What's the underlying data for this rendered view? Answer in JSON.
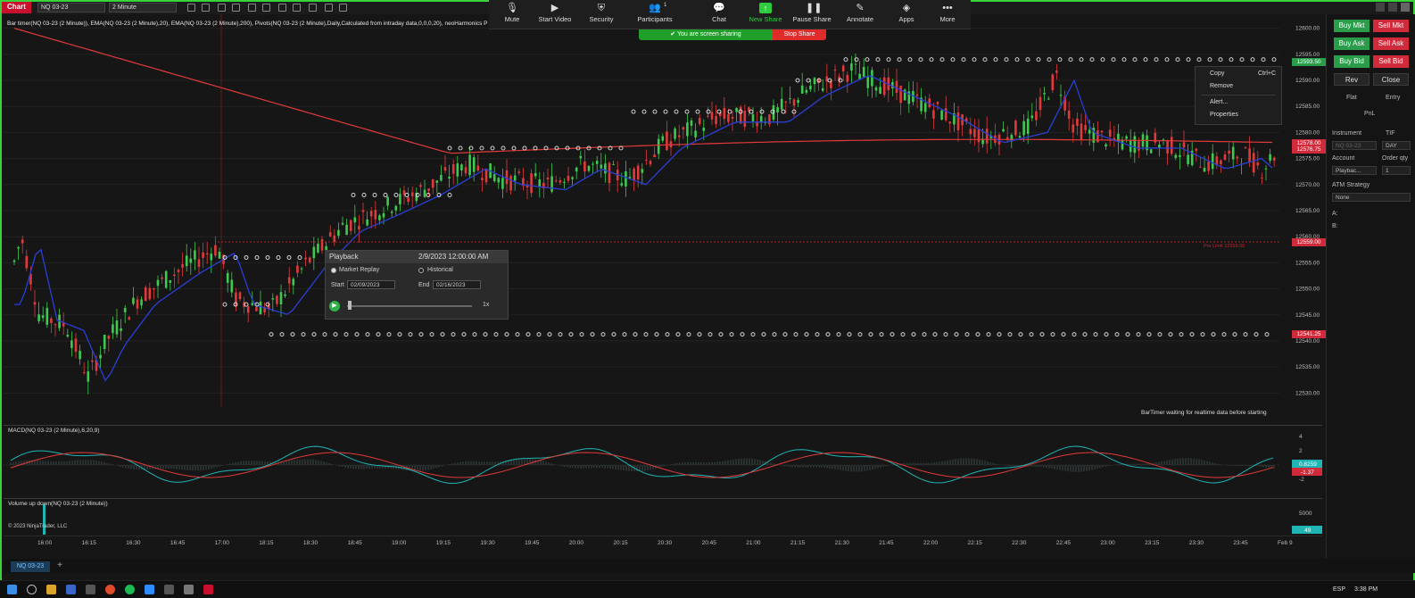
{
  "window": {
    "app_title": "Chart",
    "instrument_select": "NQ 03-23",
    "interval_select": "2 Minute"
  },
  "zoom": {
    "items": [
      {
        "label": "Mute",
        "icon": "microphone-icon"
      },
      {
        "label": "Start Video",
        "icon": "video-camera-icon"
      },
      {
        "label": "Security",
        "icon": "shield-icon"
      },
      {
        "label": "Participants",
        "icon": "participants-icon",
        "count": "1"
      },
      {
        "label": "Chat",
        "icon": "chat-icon"
      },
      {
        "label": "New Share",
        "icon": "share-arrow-icon"
      },
      {
        "label": "Pause Share",
        "icon": "pause-icon"
      },
      {
        "label": "Annotate",
        "icon": "pencil-icon"
      },
      {
        "label": "Apps",
        "icon": "apps-icon"
      },
      {
        "label": "More",
        "icon": "more-dots-icon"
      }
    ],
    "banner": "You are screen sharing",
    "stop_share": "Stop Share"
  },
  "chart": {
    "indicator_legend": "Bar timer(NQ 03-23 (2 Minute)), EMA(NQ 03-23 (2 Minute),20), EMA(NQ 03-23 (2 Minute),200), Pivots(NQ 03-23 (2 Minute),Daily,Calculated from intraday data,0,0,0,20), neoHarmonics P",
    "price_ticks": [
      "12600.00",
      "12595.00",
      "12590.00",
      "12585.00",
      "12580.00",
      "12575.00",
      "12570.00",
      "12565.00",
      "12560.00",
      "12555.00",
      "12550.00",
      "12545.00",
      "12540.00",
      "12535.00",
      "12530.00"
    ],
    "price_tags": [
      {
        "label": "12593.50",
        "color": "#2a9d4b"
      },
      {
        "label": "12578.00",
        "color": "#d12a3a"
      },
      {
        "label": "12576.75",
        "color": "#d12a3a"
      },
      {
        "label": "12559.00",
        "color": "#d12a3a"
      },
      {
        "label": "12541.25",
        "color": "#d12a3a"
      }
    ],
    "status_text": "BarTimer waiting for realtime data before starting",
    "line_label": "Pre Limit 12559.00"
  },
  "context_menu": {
    "items": [
      {
        "label": "Copy",
        "shortcut": "Ctrl+C"
      },
      {
        "label": "Remove",
        "shortcut": ""
      },
      {
        "label": "Alert...",
        "shortcut": ""
      },
      {
        "label": "Properties",
        "shortcut": ""
      }
    ]
  },
  "playback": {
    "title": "Playback",
    "datetime": "2/9/2023 12:00:00 AM",
    "mode_market_replay": "Market Replay",
    "mode_historical": "Historical",
    "start_label": "Start",
    "start_value": "02/09/2023",
    "end_label": "End",
    "end_value": "02/16/2023",
    "speed": "1x",
    "progress": 0.02
  },
  "order_panel": {
    "buy_mkt": "Buy Mkt",
    "sell_mkt": "Sell Mkt",
    "buy_ask": "Buy Ask",
    "sell_ask": "Sell Ask",
    "buy_bid": "Buy Bid",
    "sell_bid": "Sell Bid",
    "rev": "Rev",
    "close": "Close",
    "flat": "Flat",
    "entry": "Entry",
    "pnl": "PnL",
    "instrument_label": "Instrument",
    "tif_label": "TIF",
    "instrument_value": "NQ 03-23",
    "tif_value": "DAY",
    "account_label": "Account",
    "order_qty_label": "Order qty",
    "account_value": "Playbac...",
    "order_qty_value": "1",
    "atm_label": "ATM Strategy",
    "atm_value": "None",
    "a_label": "A:",
    "b_label": "B:"
  },
  "macd": {
    "label": "MACD(NQ 03-23 (2 Minute),6,20,9)",
    "ticks": [
      "4",
      "2",
      "0",
      "-2"
    ],
    "tag_pos": "0.8259",
    "tag_neg": "-1.37"
  },
  "volume": {
    "label": "Volume up down(NQ 03-23 (2 Minute))",
    "tick": "5000",
    "tag": "49",
    "copyright": "© 2023 NinjaTrader, LLC"
  },
  "time_axis": [
    "16:00",
    "16:15",
    "16:30",
    "16:45",
    "17:00",
    "18:15",
    "18:30",
    "18:45",
    "19:00",
    "19:15",
    "19:30",
    "19:45",
    "20:00",
    "20:15",
    "20:30",
    "20:45",
    "21:00",
    "21:15",
    "21:30",
    "21:45",
    "22:00",
    "22:15",
    "22:30",
    "22:45",
    "23:00",
    "23:15",
    "23:30",
    "23:45",
    "Feb 9"
  ],
  "tabs": {
    "chart_tab": "NQ 03-23",
    "add": "+"
  },
  "taskbar": {
    "lang": "ESP",
    "time": "3:38 PM"
  }
}
